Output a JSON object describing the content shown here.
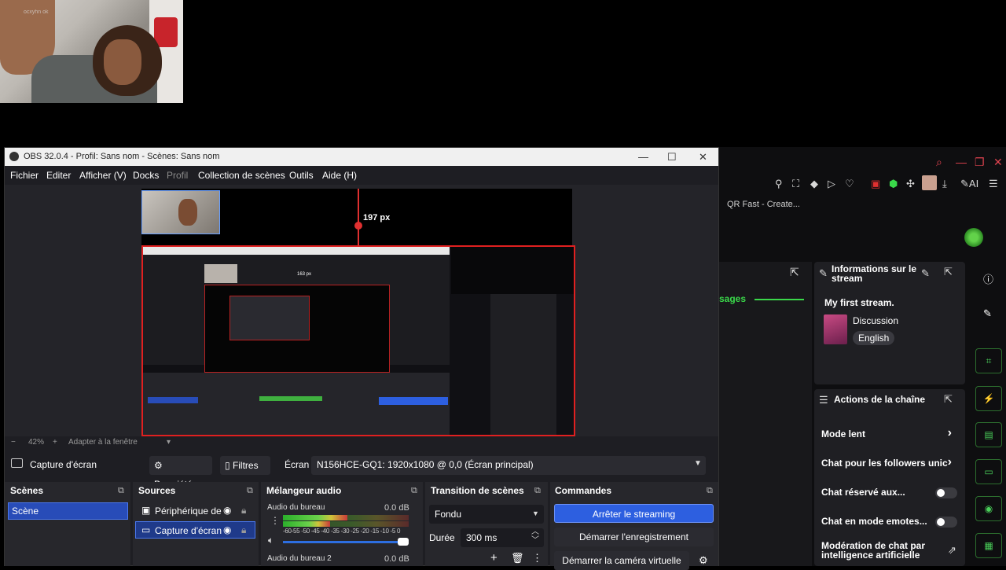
{
  "webcam": {
    "watermark": "ocxyhn ok"
  },
  "obs": {
    "title": "OBS 32.0.4 - Profil: Sans nom - Scènes: Sans nom",
    "menu": [
      "Fichier",
      "Editer",
      "Afficher (V)",
      "Docks",
      "Profil",
      "Collection de scènes",
      "Outils",
      "Aide (H)"
    ],
    "preview": {
      "distance_label": "197 px",
      "nested_label": "163 px"
    },
    "zoom": {
      "minus": "−",
      "value": "42%",
      "plus": "+",
      "fit": "Adapter à la fenêtre",
      "caret": "▾"
    },
    "source_toolbar": {
      "source_name": "Capture d'écran",
      "properties": "Propriétés",
      "filters": "Filtres",
      "screen_label": "Écran",
      "screen_value": "N156HCE-GQ1: 1920x1080 @ 0,0 (Écran principal)"
    },
    "scenes": {
      "title": "Scènes",
      "items": [
        "Scène"
      ]
    },
    "sources": {
      "title": "Sources",
      "items": [
        "Périphérique de",
        "Capture d'écran"
      ]
    },
    "mixer": {
      "title": "Mélangeur audio",
      "channels": [
        {
          "name": "Audio du bureau",
          "db": "0.0 dB"
        },
        {
          "name": "Audio du bureau 2",
          "db": "0.0 dB"
        }
      ],
      "scale": "-60-55 -50 -45 -40 -35 -30 -25 -20 -15 -10  -5  0"
    },
    "transitions": {
      "title": "Transition de scènes",
      "type": "Fondu",
      "duration_label": "Durée",
      "duration_value": "300 ms"
    },
    "controls": {
      "title": "Commandes",
      "buttons": [
        "Arrêter le streaming",
        "Démarrer l'enregistrement",
        "Démarrer la caméra virtuelle"
      ]
    }
  },
  "browser": {
    "tab_title": "QR Fast - Create...",
    "ai_label": "AI",
    "messages_label": "sages",
    "stream_info": {
      "title": "Informations sur le stream",
      "stream_title": "My first stream.",
      "category": "Discussion",
      "language": "English"
    },
    "channel_actions": {
      "title": "Actions de la chaîne",
      "items": [
        "Mode lent",
        "Chat pour les followers unic",
        "Chat réservé aux...",
        "Chat en mode emotes...",
        "Modération de chat par intelligence artificielle"
      ]
    }
  },
  "colors": {
    "accent_blue": "#284cb8",
    "recording_red": "#e03030",
    "twitch_green": "#3ad84a"
  }
}
